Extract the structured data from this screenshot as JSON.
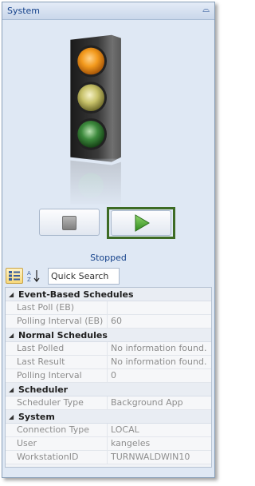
{
  "window": {
    "title": "System",
    "pin_glyph": "⌓"
  },
  "traffic_light": {
    "state": "stopped",
    "colors": {
      "top": "#f39a1d",
      "middle": "#c8c26a",
      "bottom": "#3d8a3d"
    }
  },
  "controls": {
    "stop_icon": "stop-icon",
    "play_icon": "play-icon"
  },
  "status": {
    "text": "Stopped"
  },
  "toolbar": {
    "search_placeholder": "Quick Search"
  },
  "property_grid": {
    "categories": [
      {
        "name": "Event-Based Schedules",
        "rows": [
          {
            "name": "Last Poll (EB)",
            "value": ""
          },
          {
            "name": "Polling Interval (EB)",
            "value": "60"
          }
        ]
      },
      {
        "name": "Normal Schedules",
        "rows": [
          {
            "name": "Last Polled",
            "value": "No information found."
          },
          {
            "name": "Last Result",
            "value": "No information found."
          },
          {
            "name": "Polling Interval",
            "value": "0"
          }
        ]
      },
      {
        "name": "Scheduler",
        "rows": [
          {
            "name": "Scheduler Type",
            "value": "Background App"
          }
        ]
      },
      {
        "name": "System",
        "rows": [
          {
            "name": "Connection Type",
            "value": "LOCAL"
          },
          {
            "name": "User",
            "value": "kangeles"
          },
          {
            "name": "WorkstationID",
            "value": "TURNWALDWIN10"
          }
        ]
      }
    ]
  }
}
